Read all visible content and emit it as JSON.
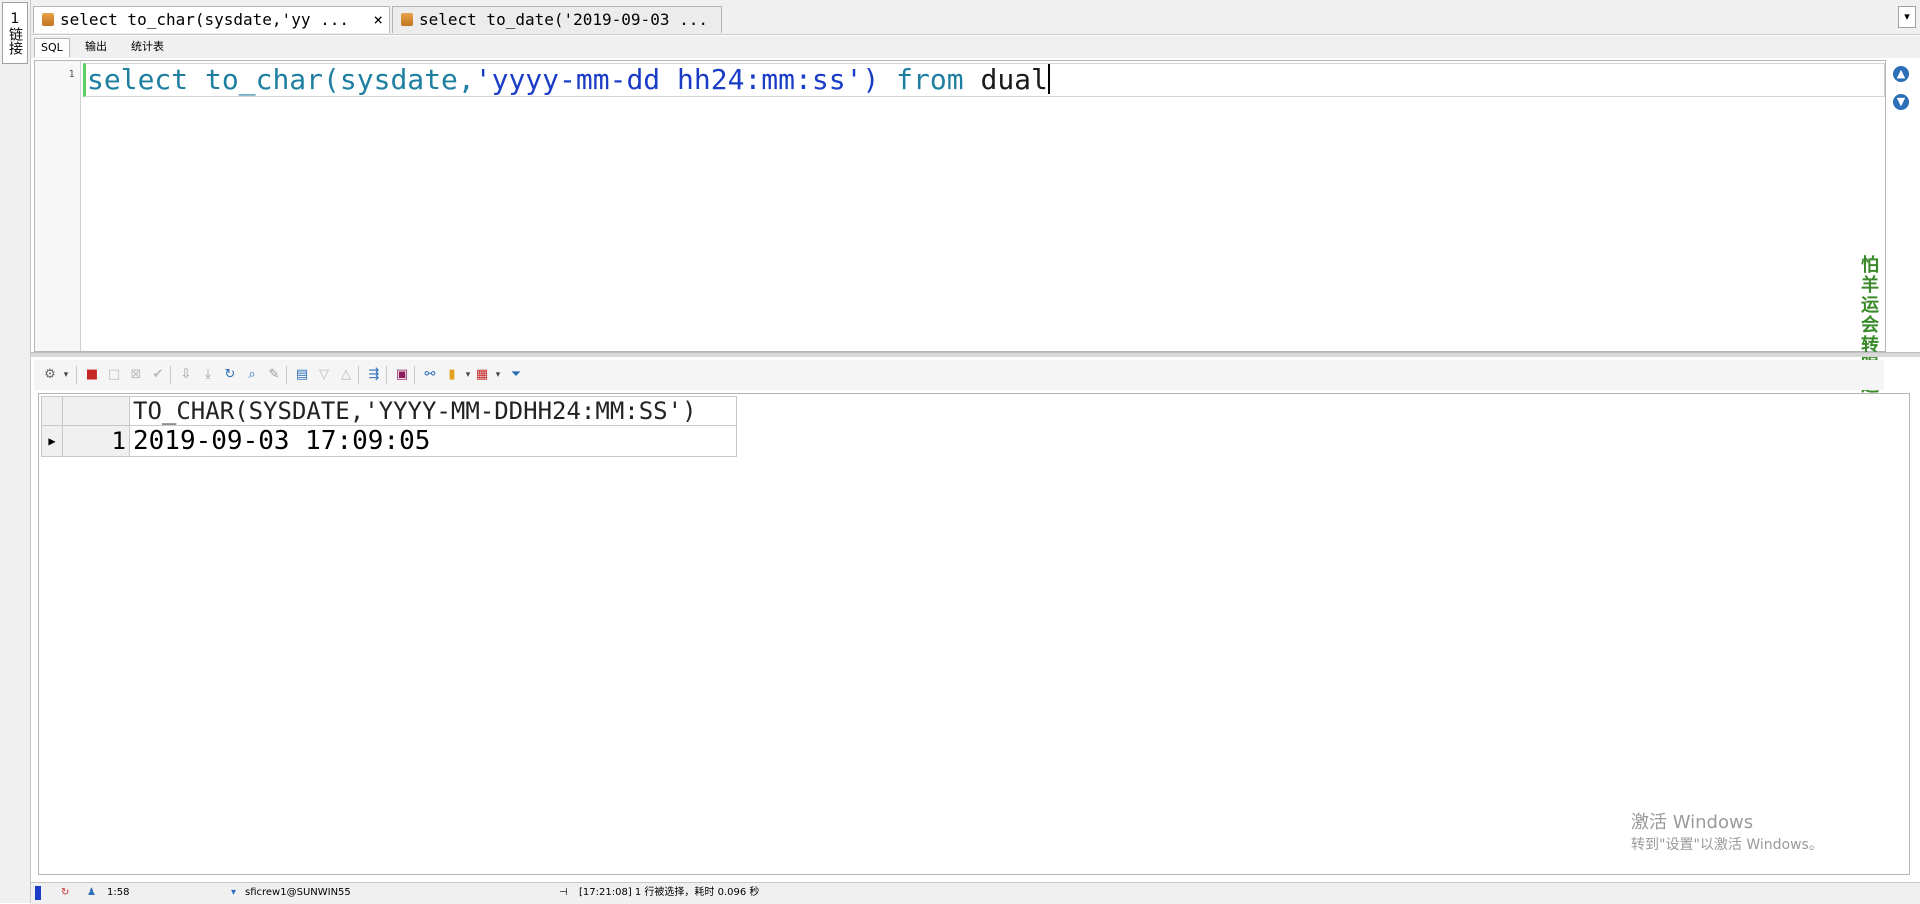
{
  "left_panel": {
    "vertical_tab_label": "1链接"
  },
  "tabs": [
    {
      "label": "select to_char(sysdate,'yy ...",
      "close": "×",
      "active": true
    },
    {
      "label": "select to_date('2019-09-03 ...",
      "active": false
    }
  ],
  "tab_menu_icon": "chevron-down-icon",
  "subtabs": [
    "SQL",
    "输出",
    "统计表"
  ],
  "editor": {
    "line_number": "1",
    "code": {
      "kw_select": "select",
      "sp1": " ",
      "fn": "to_char(sysdate,",
      "str": "'yyyy-mm-dd hh24:mm:ss')",
      "sp2": " ",
      "kw_from": "from",
      "sp3": " ",
      "ident": "dual"
    }
  },
  "side_text": "怕羊运会转眼远逝",
  "result_grid": {
    "columns": [
      "TO_CHAR(SYSDATE,'YYYY-MM-DDHH24:MM:SS')"
    ],
    "rows": [
      {
        "row_number": "1",
        "values": [
          "2019-09-03 17:09:05"
        ]
      }
    ]
  },
  "watermark": {
    "line1": "激活 Windows",
    "line2": "转到\"设置\"以激活 Windows。"
  },
  "statusbar": {
    "position": "1:58",
    "connection": "sficrew1@SUNWIN55",
    "message": "[17:21:08]  1 行被选择，耗时 0.096 秒"
  },
  "colors": {
    "keyword": "#1f7fa0",
    "string": "#1a3cc7",
    "accent_green": "#3a8a2a"
  }
}
